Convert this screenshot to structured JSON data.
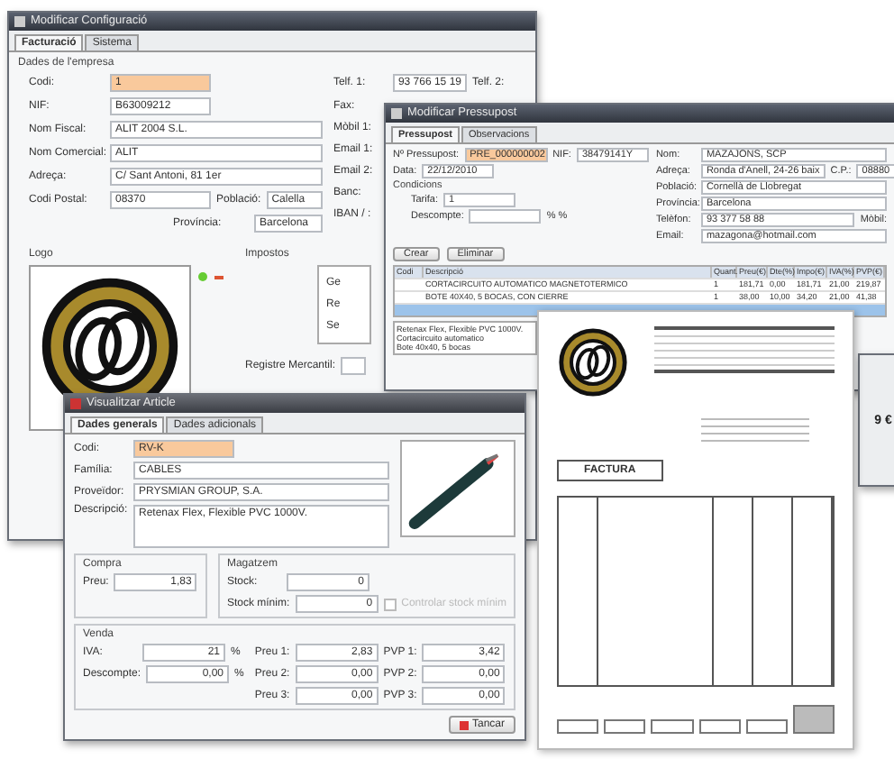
{
  "config_window": {
    "title": "Modificar Configuració",
    "tabs": [
      {
        "label": "Facturació",
        "selected": true
      },
      {
        "label": "Sistema",
        "selected": false
      }
    ],
    "section": "Dades de l'empresa",
    "left_rows": [
      [
        {
          "label": "Codi:",
          "value": "1",
          "key": true
        }
      ],
      [
        {
          "label": "NIF:",
          "value": "B63009212",
          "key": false
        }
      ],
      [
        {
          "label": "Nom Fiscal:",
          "value": "ALIT 2004 S.L.",
          "key": false
        }
      ],
      [
        {
          "label": "Nom Comercial:",
          "value": "ALIT",
          "key": false
        }
      ],
      [
        {
          "label": "Adreça:",
          "value": "C/ Sant Antoni, 81 1er",
          "key": false
        }
      ],
      [
        {
          "label": "Codi Postal:",
          "value": "08370",
          "key": false
        },
        {
          "label": "Població:",
          "value": "Calella",
          "key": false
        }
      ],
      [
        {
          "label": "Província:",
          "value": "Barcelona",
          "key": false
        }
      ]
    ],
    "right_fields": [
      {
        "label": "Telf. 1:",
        "value": "93 766 15 19"
      },
      {
        "label": "Fax:"
      },
      {
        "label": "Mòbil 1:"
      },
      {
        "label": "Email 1:"
      },
      {
        "label": "Email 2:"
      },
      {
        "label": "Banc:"
      },
      {
        "label": "IBAN / :"
      }
    ],
    "phone2_label": "Telf. 2:",
    "logo_label": "Logo",
    "taxes_label": "Impostos",
    "tax_buttons": [
      "Ge",
      "Re",
      "Se"
    ],
    "registry_label": "Registre Mercantil:"
  },
  "budget_window": {
    "title": "Modificar Pressupost",
    "tabs": [
      {
        "label": "Pressupost",
        "selected": true
      },
      {
        "label": "Observacions",
        "selected": false
      }
    ],
    "number": {
      "label": "Nº Pressupost:",
      "value": "PRE_000000002"
    },
    "nif": {
      "label": "NIF:",
      "value": "38479141Y"
    },
    "date": {
      "label": "Data:",
      "value": "22/12/2010"
    },
    "conditions_label": "Condicions",
    "rate": {
      "label": "Tarifa:",
      "value": "1"
    },
    "discount": {
      "label": "Descompte:",
      "unit": "% %"
    },
    "client_fields": [
      {
        "label": "Nom:",
        "value": "MAZAJONS, SCP"
      },
      {
        "label": "Adreça:",
        "value": "Ronda d'Anell, 24-26 baix"
      },
      {
        "label": "Població:",
        "value": "Cornellà de Llobregat"
      },
      {
        "label": "Província:",
        "value": "Barcelona"
      },
      {
        "label": "Telèfon:",
        "value": "93 377 58 88"
      },
      {
        "label": "Email:",
        "value": "mazagona@hotmail.com"
      }
    ],
    "postcode": {
      "label": "C.P.:",
      "value": "08880"
    },
    "mobile_label": "Mòbil:",
    "buttons": [
      "Crear",
      "Eliminar"
    ],
    "columns": [
      "Codi",
      "Descripció",
      "Quant.",
      "Preu(€)",
      "Dte(%)",
      "Impo(€)",
      "IVA(%)",
      "PVP(€)"
    ],
    "rows": [
      {
        "selected": false,
        "cells": [
          "",
          "CORTACIRCUITO AUTOMATICO MAGNETOTERMICO",
          "1",
          "181,71",
          "0,00",
          "181,71",
          "21,00",
          "219,87"
        ]
      },
      {
        "selected": false,
        "cells": [
          "",
          "BOTE 40X40, 5 BOCAS, CON CIERRE",
          "1",
          "38,00",
          "10,00",
          "34,20",
          "21,00",
          "41,38"
        ]
      },
      {
        "selected": true,
        "cells": [
          "",
          "",
          "",
          "",
          "",
          "",
          "",
          ""
        ]
      }
    ],
    "list_lines": [
      "Retenax Flex, Flexible PVC 1000V.",
      "Cortacircuito automatico",
      "Bote 40x40, 5 bocas"
    ]
  },
  "invoice_document": {
    "title": "FACTURA",
    "side_total": "9 €"
  },
  "article_window": {
    "title": "Visualitzar Article",
    "tabs": [
      {
        "label": "Dades generals",
        "selected": true
      },
      {
        "label": "Dades adicionals",
        "selected": false
      }
    ],
    "code": {
      "label": "Codi:",
      "value": "RV-K"
    },
    "family": {
      "label": "Família:",
      "value": "CABLES"
    },
    "supplier": {
      "label": "Proveïdor:",
      "value": "PRYSMIAN GROUP, S.A."
    },
    "description": {
      "label": "Descripció:",
      "value": "Retenax Flex, Flexible PVC 1000V."
    },
    "purchase": {
      "title": "Compra",
      "label": "Preu:",
      "value": "1,83"
    },
    "stock": {
      "title": "Magatzem",
      "stock_label": "Stock:",
      "stock_value": "0",
      "min_label": "Stock mínim:",
      "min_value": "0",
      "control_label": "Controlar stock mínim",
      "checked": false
    },
    "sale": {
      "title": "Venda",
      "vat": {
        "label": "IVA:",
        "value": "21",
        "unit": "%"
      },
      "discount": {
        "label": "Descompte:",
        "value": "0,00",
        "unit": "%"
      },
      "prices": [
        {
          "label": "Preu 1:",
          "value": "2,83",
          "pvp_label": "PVP 1:",
          "pvp": "3,42"
        },
        {
          "label": "Preu 2:",
          "value": "0,00",
          "pvp_label": "PVP 2:",
          "pvp": "0,00"
        },
        {
          "label": "Preu 3:",
          "value": "0,00",
          "pvp_label": "PVP 3:",
          "pvp": "0,00"
        }
      ]
    },
    "close_button": "Tancar"
  }
}
